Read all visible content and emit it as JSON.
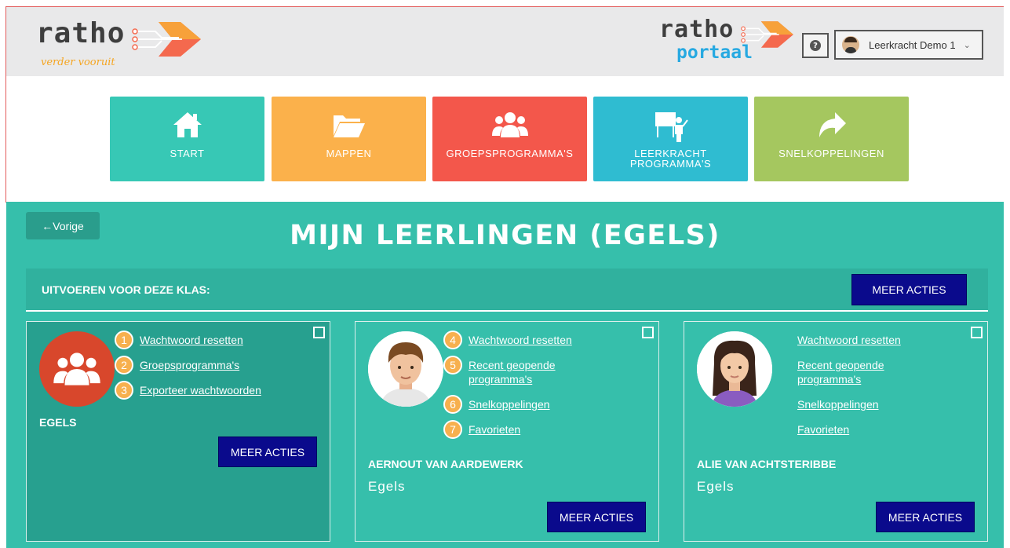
{
  "header": {
    "logo": {
      "word": "ratho",
      "tagline": "verder vooruit"
    },
    "portal_logo": {
      "word": "ratho",
      "sub": "portaal"
    },
    "help_icon": "question-circle-icon",
    "user": {
      "name": "Leerkracht Demo 1"
    }
  },
  "nav": {
    "tiles": [
      {
        "label": "START",
        "icon": "home-icon",
        "color": "#37c8b5"
      },
      {
        "label": "MAPPEN",
        "icon": "folder-open-icon",
        "color": "#fbb14b"
      },
      {
        "label": "GROEPSPROGRAMMA'S",
        "icon": "users-icon",
        "color": "#f3574b"
      },
      {
        "label_line1": "LEERKRACHT",
        "label_line2": "PROGRAMMA'S",
        "icon": "teacher-board-icon",
        "color": "#2fbcd1"
      },
      {
        "label": "SNELKOPPELINGEN",
        "icon": "share-arrow-icon",
        "color": "#a5c75f"
      }
    ]
  },
  "main": {
    "back_label": "Vorige",
    "title": "MIJN LEERLINGEN (EGELS)",
    "bar": {
      "label": "UITVOEREN VOOR DEZE KLAS:",
      "button": "MEER ACTIES"
    }
  },
  "cards": [
    {
      "name": "EGELS",
      "links": [
        {
          "badge": "1",
          "label": "Wachtwoord resetten"
        },
        {
          "badge": "2",
          "label": "Groepsprogramma's"
        },
        {
          "badge": "3",
          "label": "Exporteer wachtwoorden"
        }
      ],
      "button": "MEER ACTIES"
    },
    {
      "name": "AERNOUT VAN AARDEWERK",
      "group": "Egels",
      "links": [
        {
          "badge": "4",
          "label": "Wachtwoord resetten"
        },
        {
          "badge": "5",
          "label_line1": "Recent geopende",
          "label_line2": "programma's"
        },
        {
          "badge": "6",
          "label": "Snelkoppelingen"
        },
        {
          "badge": "7",
          "label": "Favorieten"
        }
      ],
      "button": "MEER ACTIES"
    },
    {
      "name": "ALIE VAN ACHTSTERIBBE",
      "group": "Egels",
      "links": [
        {
          "label": "Wachtwoord resetten"
        },
        {
          "label_line1": "Recent geopende",
          "label_line2": "programma's"
        },
        {
          "label": "Snelkoppelingen"
        },
        {
          "label": "Favorieten"
        }
      ],
      "button": "MEER ACTIES"
    }
  ],
  "colors": {
    "teal": "#36bfab",
    "teal_dark": "#27a08f",
    "navy_button": "#0a0a8c",
    "badge_orange": "#f7b04e",
    "group_avatar": "#d8472c"
  }
}
